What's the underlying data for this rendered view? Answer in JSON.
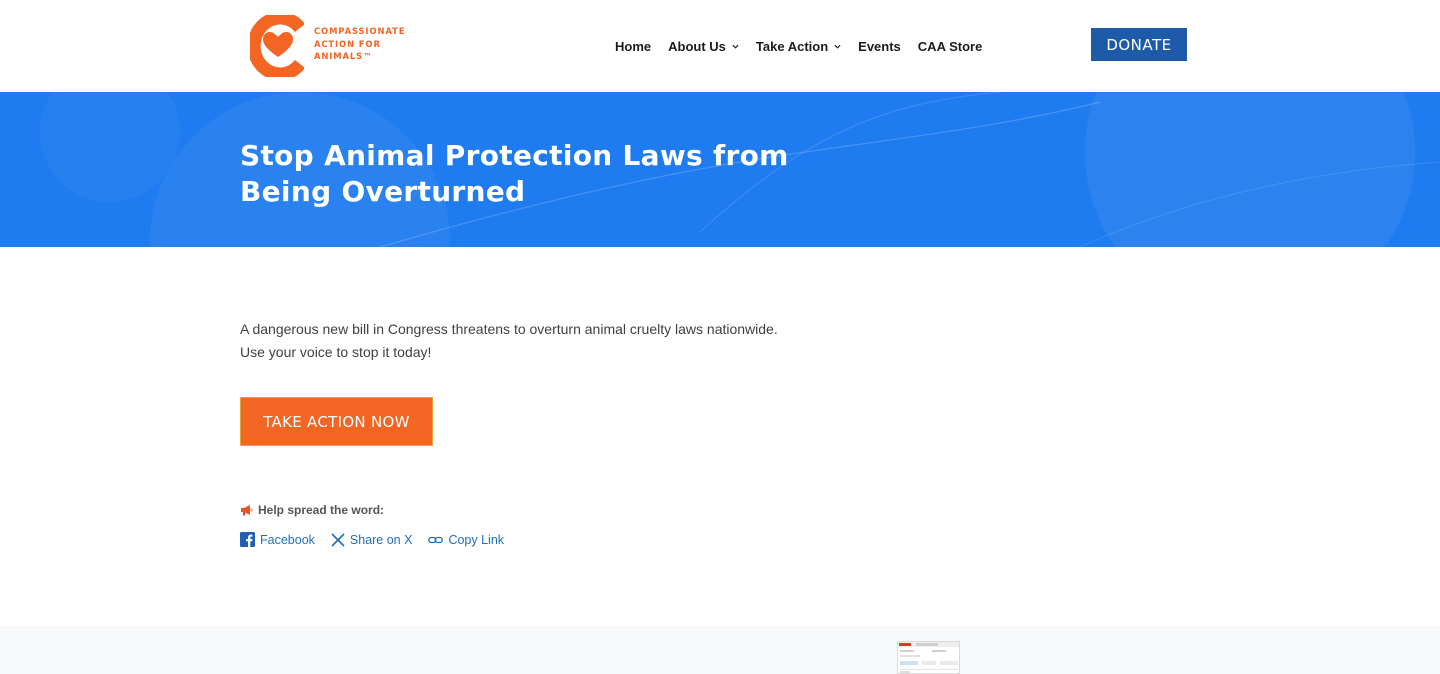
{
  "brand": {
    "logo_lines": [
      "COMPASSIONATE",
      "ACTION FOR",
      "ANIMALS™"
    ],
    "logo_icon": "caa-heart-logo",
    "accent_color": "#f26522",
    "primary_blue": "#1f7cf0"
  },
  "nav": {
    "items": [
      {
        "label": "Home",
        "has_dropdown": false
      },
      {
        "label": "About Us",
        "has_dropdown": true
      },
      {
        "label": "Take Action",
        "has_dropdown": true
      },
      {
        "label": "Events",
        "has_dropdown": false
      },
      {
        "label": "CAA Store",
        "has_dropdown": false
      }
    ],
    "donate_label": "DONATE",
    "donate_color": "#1d5aa8"
  },
  "hero": {
    "title": "Stop Animal Protection Laws from Being Overturned"
  },
  "content": {
    "intro_line_1": "A dangerous new bill in Congress threatens to overturn animal cruelty laws nationwide.",
    "intro_line_2": "Use your voice to stop it today!",
    "cta_label": "TAKE ACTION NOW"
  },
  "share": {
    "label": "Help spread the word:",
    "label_icon": "megaphone-icon",
    "links": [
      {
        "label": "Facebook",
        "icon": "facebook-icon"
      },
      {
        "label": "Share on X",
        "icon": "x-icon"
      },
      {
        "label": "Copy Link",
        "icon": "link-icon"
      }
    ]
  }
}
